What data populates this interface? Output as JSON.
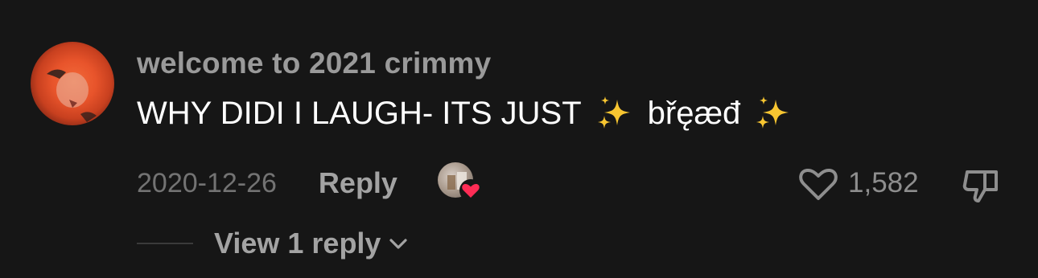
{
  "comment": {
    "username": "welcome to 2021 crimmy",
    "text_part1": "WHY DIDI I LAUGH- ITS JUST",
    "text_part2": "břęæđ",
    "date": "2020-12-26",
    "reply_label": "Reply",
    "like_count": "1,582",
    "view_replies_label": "View 1 reply"
  },
  "colors": {
    "background": "#161616",
    "heart_badge": "#fe2c55",
    "sparkle": "#f7c531"
  },
  "icons": {
    "sparkle": "sparkles-icon",
    "like": "heart-outline-icon",
    "dislike": "thumbs-down-icon",
    "liked_badge": "heart-filled-icon",
    "expand": "chevron-down-icon"
  }
}
